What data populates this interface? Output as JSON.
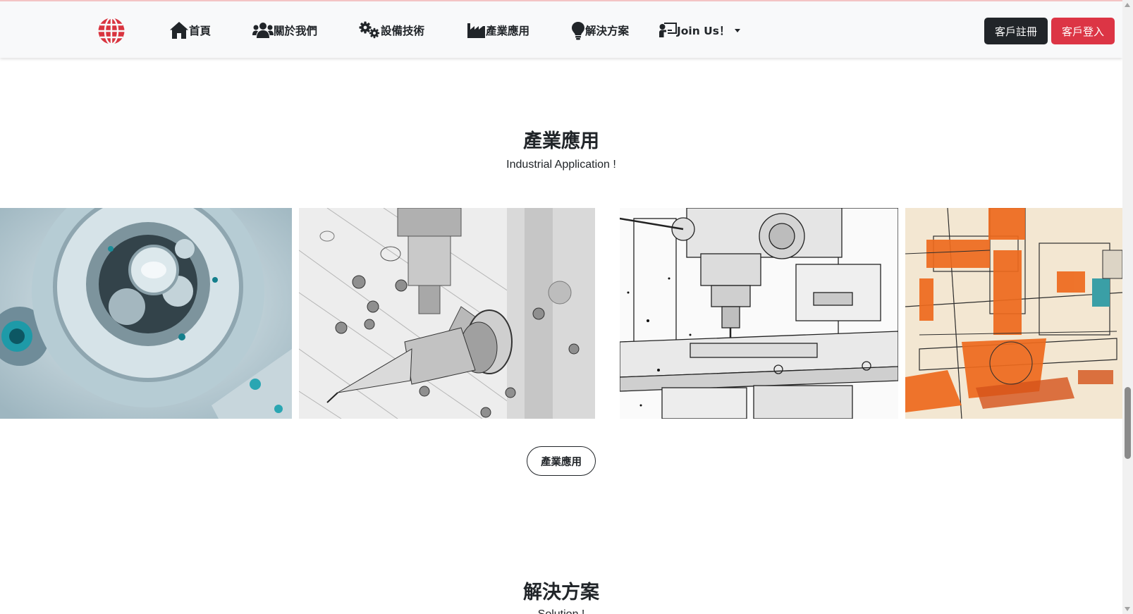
{
  "nav": {
    "items": [
      {
        "label": "首頁",
        "icon": "home-icon"
      },
      {
        "label": "關於我們",
        "icon": "users-icon"
      },
      {
        "label": "設備技術",
        "icon": "gears-icon"
      },
      {
        "label": "產業應用",
        "icon": "industry-icon"
      },
      {
        "label": "解決方案",
        "icon": "lightbulb-icon"
      },
      {
        "label": "Join Us！",
        "icon": "chalkboard-teacher-icon"
      }
    ],
    "register_label": "客戶註冊",
    "login_label": "客戶登入"
  },
  "industry": {
    "title": "產業應用",
    "subtitle": "Industrial Application !",
    "images": [
      {
        "icon": "watch-mechanism-image"
      },
      {
        "icon": "drill-sketch-image"
      },
      {
        "icon": "cnc-machine-sketch-image"
      },
      {
        "icon": "orange-machine-sketch-image"
      }
    ],
    "button_label": "產業應用"
  },
  "solution": {
    "title": "解決方案",
    "subtitle": "Solution !"
  },
  "colors": {
    "accent": "#dc3545",
    "dark": "#212529",
    "navbar_bg": "#f8f9fa",
    "logo": "#d9343f"
  }
}
